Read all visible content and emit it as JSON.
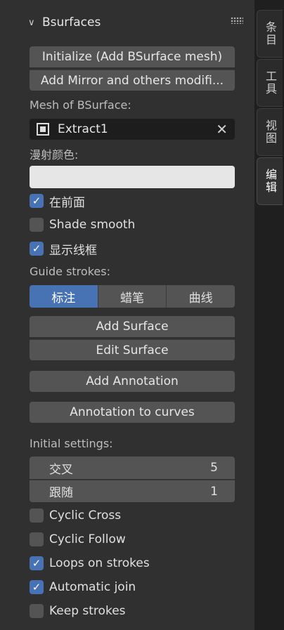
{
  "panel": {
    "title": "Bsurfaces",
    "init_button": "Initialize (Add BSurface mesh)",
    "mirror_button": "Add Mirror and others modifi...",
    "mesh_label": "Mesh of BSurface:",
    "mesh_value": "Extract1",
    "diffuse_label": "漫射颜色:",
    "diffuse_color": "#e6e6e6",
    "in_front": "在前面",
    "shade_smooth": "Shade smooth",
    "show_wire": "显示线框",
    "guide_label": "Guide strokes:",
    "guide_options": [
      "标注",
      "蜡笔",
      "曲线"
    ],
    "add_surface": "Add Surface",
    "edit_surface": "Edit Surface",
    "add_annotation": "Add Annotation",
    "annotation_to_curves": "Annotation to curves",
    "initial_label": "Initial settings:",
    "cross_label": "交叉",
    "cross_value": "5",
    "follow_label": "跟随",
    "follow_value": "1",
    "cyclic_cross": "Cyclic Cross",
    "cyclic_follow": "Cyclic Follow",
    "loops_on_strokes": "Loops on strokes",
    "automatic_join": "Automatic join",
    "keep_strokes": "Keep strokes"
  },
  "tabs": [
    "条目",
    "工具",
    "视图",
    "编辑"
  ],
  "colors": {
    "accent": "#4772b3",
    "button": "#545454",
    "panel": "#303030"
  }
}
